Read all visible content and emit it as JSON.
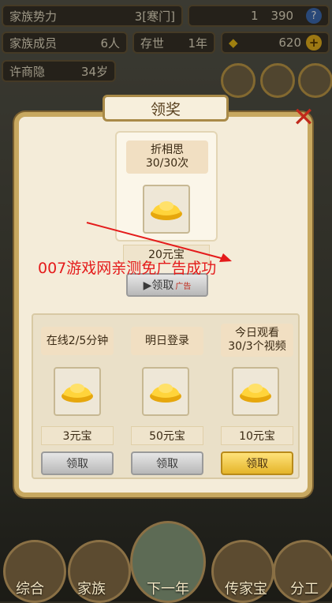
{
  "top_stats": {
    "family_power_label": "家族势力",
    "family_power_value": "3[寒门]",
    "currency_value": "1",
    "gems_value": "390",
    "help_icon": "?",
    "members_label": "家族成员",
    "members_value": "6人",
    "alive_label": "存世",
    "alive_value": "1年",
    "gold_value": "620",
    "plus_icon": "+",
    "person_name": "许商隐",
    "person_age": "34岁"
  },
  "dialog": {
    "title": "领奖",
    "top_reward": {
      "label": "折相思\n30/30次",
      "label_line1": "折相思",
      "label_line2": "30/30次",
      "amount": "20元宝",
      "button": "▶领取",
      "ad_tag": "广告"
    },
    "rewards": [
      {
        "label": "在线2/5分钟",
        "amount": "3元宝",
        "button": "领取",
        "active": false
      },
      {
        "label": "明日登录",
        "amount": "50元宝",
        "button": "领取",
        "active": false
      },
      {
        "label_line1": "今日观看",
        "label_line2": "30/3个视频",
        "amount": "10元宝",
        "button": "领取",
        "active": true
      }
    ]
  },
  "watermark": "007游戏网亲测免广告成功",
  "bottom_nav": {
    "items": [
      "综合",
      "家族",
      "下一年",
      "传家宝",
      "分工"
    ]
  },
  "colors": {
    "accent_red": "#e41b1b",
    "gold_button": "#e5b52a"
  }
}
